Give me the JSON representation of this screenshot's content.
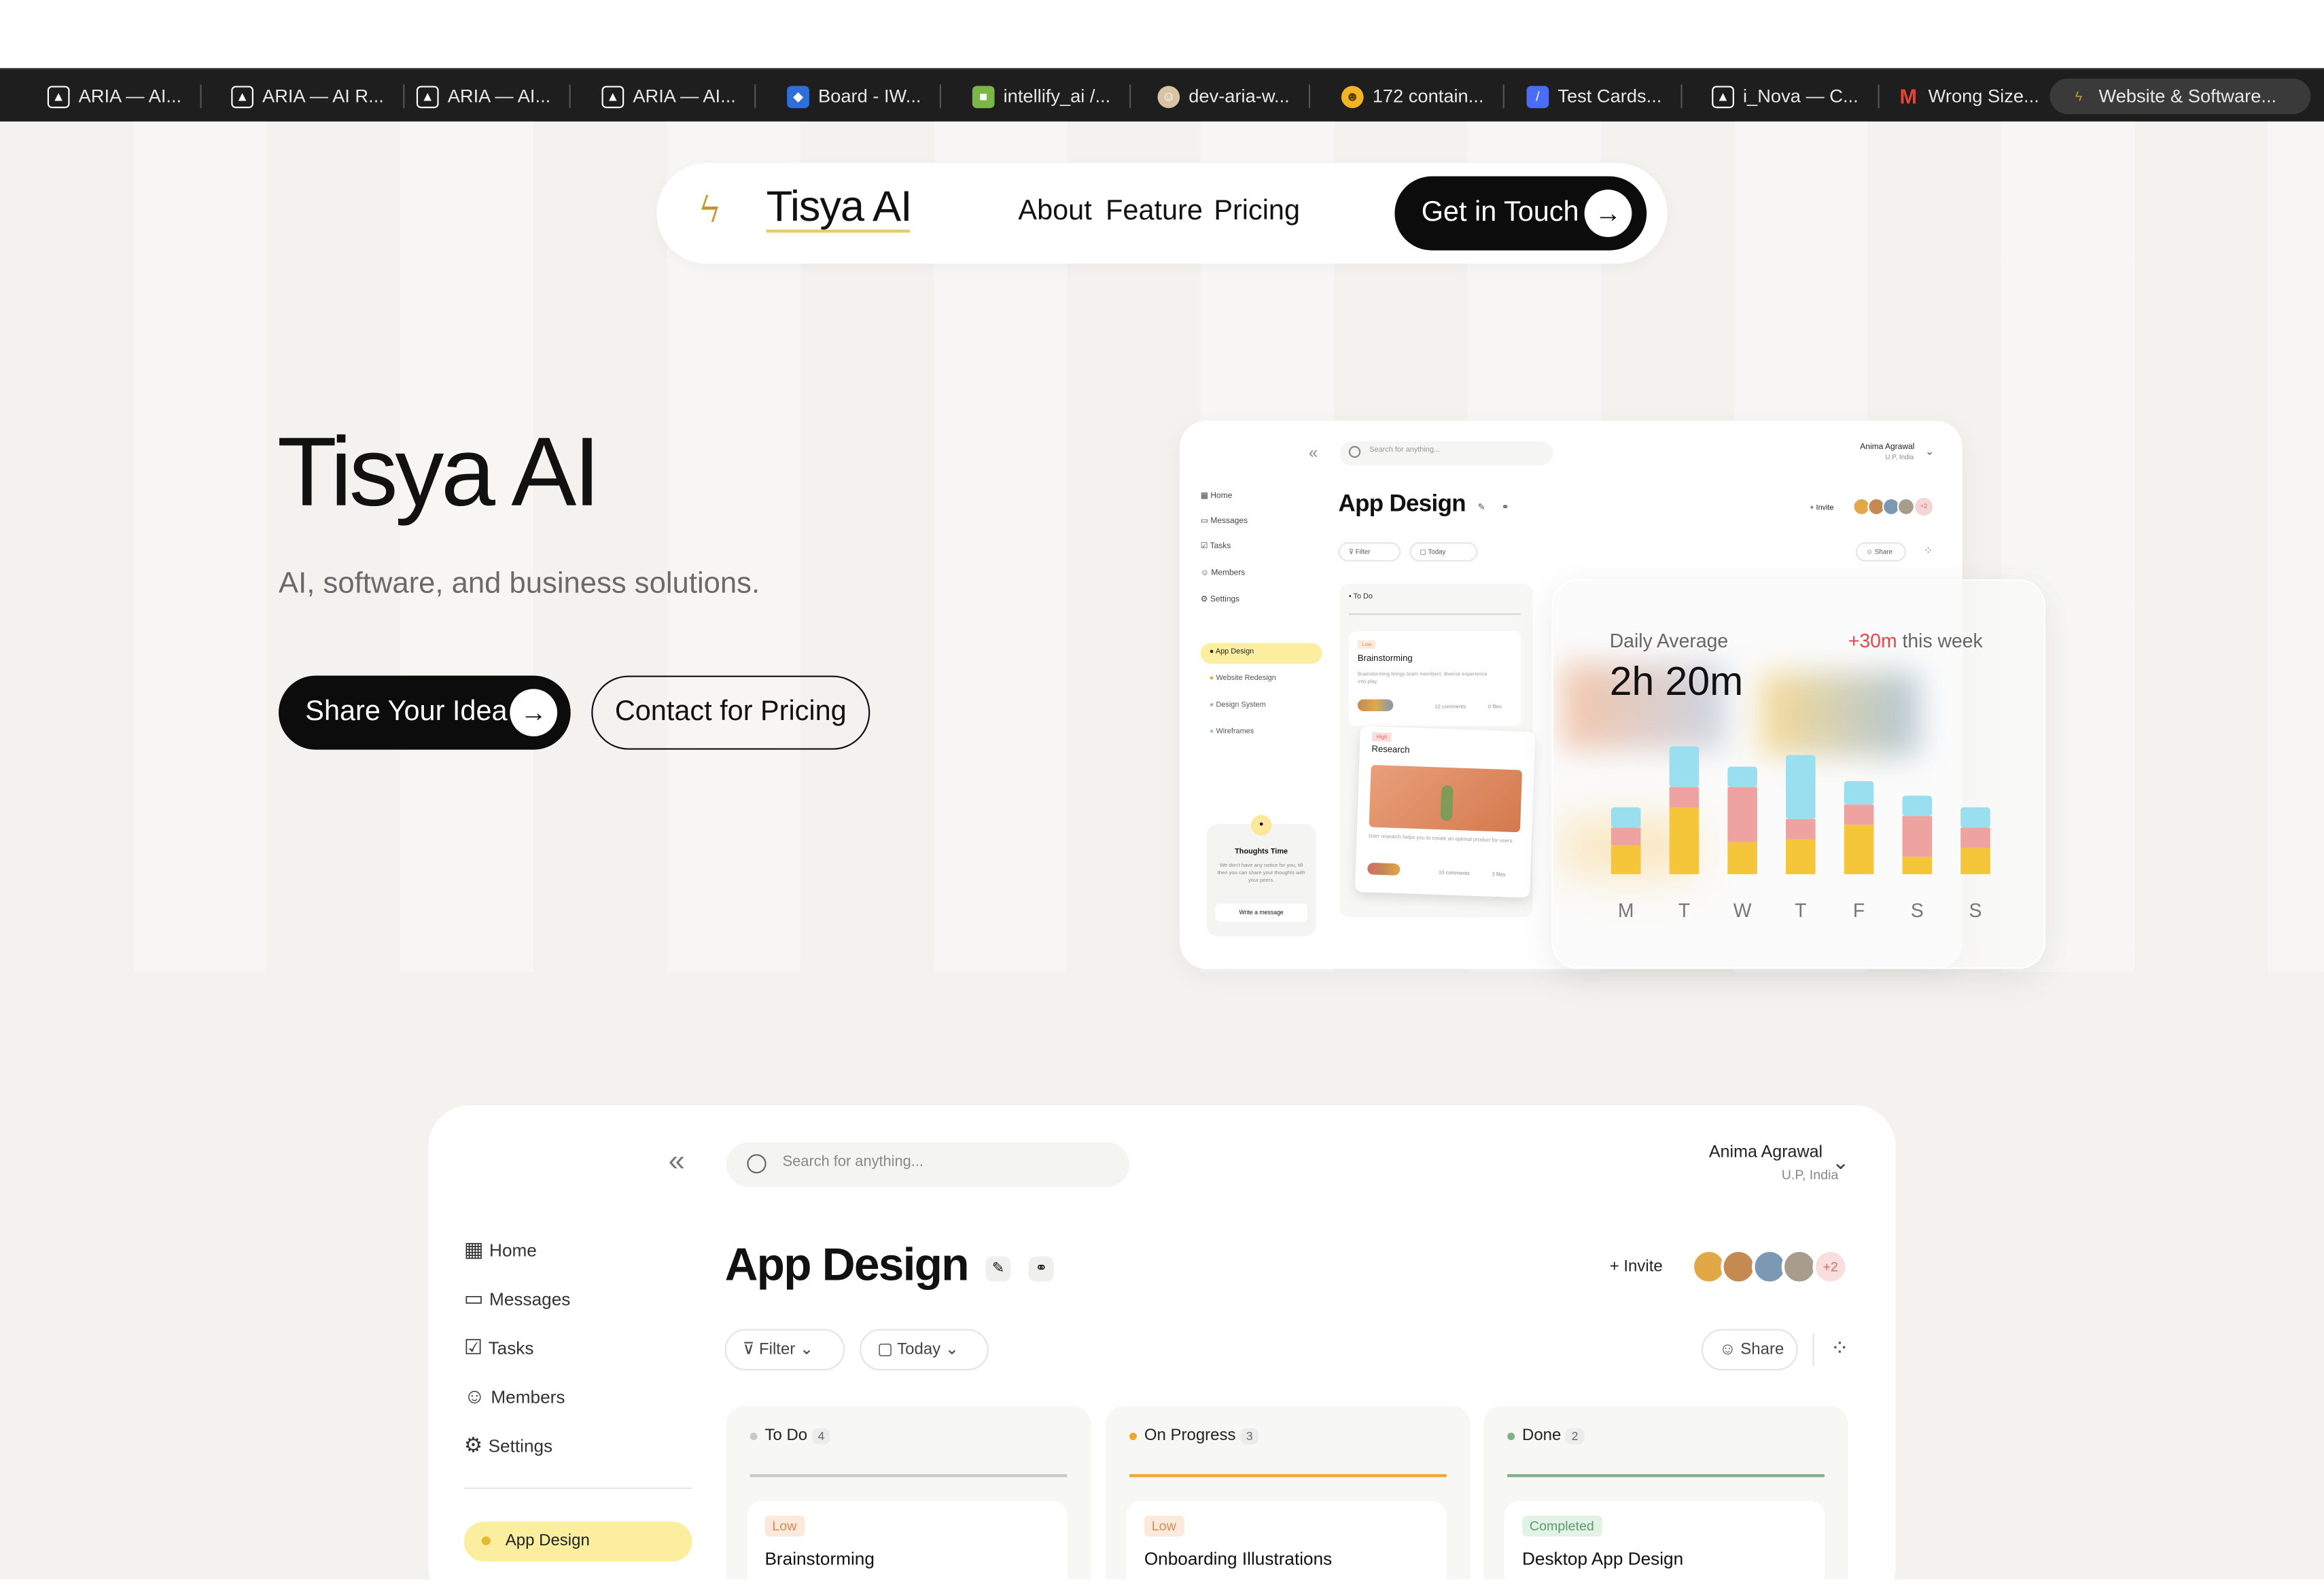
{
  "browser": {
    "tabs": [
      {
        "label": "ARIA — AI...",
        "icon": "aria-icon",
        "color": "#ffffff"
      },
      {
        "label": "ARIA — AI R...",
        "icon": "aria-icon",
        "color": "#ffffff"
      },
      {
        "label": "ARIA — AI...",
        "icon": "aria-icon",
        "color": "#ffffff"
      },
      {
        "label": "ARIA — AI...",
        "icon": "aria-icon",
        "color": "#ffffff"
      },
      {
        "label": "Board - IW...",
        "icon": "jira-icon",
        "color": "#2f6fdc"
      },
      {
        "label": "intellify_ai /...",
        "icon": "bitbucket-icon",
        "color": "#7ab648"
      },
      {
        "label": "dev-aria-w...",
        "icon": "avatar-icon",
        "color": "#d9c3a5"
      },
      {
        "label": "172 contain...",
        "icon": "emoji-icon",
        "color": "#f0b429"
      },
      {
        "label": "Test Cards...",
        "icon": "stripe-icon",
        "color": "#4a6cf7"
      },
      {
        "label": "i_Nova — C...",
        "icon": "aria-icon",
        "color": "#ffffff"
      },
      {
        "label": "Wrong Size...",
        "icon": "gmail-icon",
        "color": "#ea4335"
      },
      {
        "label": "Website & Software...",
        "icon": "tisya-icon",
        "color": "#c8962e",
        "active": true
      }
    ]
  },
  "nav": {
    "brand": "Tisya AI",
    "links": [
      "About",
      "Feature",
      "Pricing"
    ],
    "cta": "Get in Touch"
  },
  "hero": {
    "title": "Tisya AI",
    "subtitle": "AI, software, and business solutions.",
    "primary_button": "Share Your Idea",
    "secondary_button": "Contact for Pricing"
  },
  "preview": {
    "search_placeholder": "Search for anything...",
    "user_name": "Anima Agrawal",
    "user_location": "U.P, India",
    "title": "App Design",
    "invite": "Invite",
    "avatars_more": "+2",
    "filter": "Filter",
    "today": "Today",
    "share": "Share",
    "sidebar": [
      "Home",
      "Messages",
      "Tasks",
      "Members",
      "Settings"
    ],
    "projects": [
      "App Design",
      "Website Redesign",
      "Design System",
      "Wireframes"
    ],
    "thoughts_title": "Thoughts Time",
    "thoughts_text": "We don't have any notice for you, till then you can share your thoughts with your peers.",
    "thoughts_button": "Write a message",
    "todo_label": "To Do",
    "card1_tag": "Low",
    "card1_title": "Brainstorming",
    "card1_desc": "Brainstorming brings team members' diverse experience into play.",
    "card1_comments": "12 comments",
    "card1_files": "0 files",
    "card2_tag": "High",
    "card2_title": "Research",
    "card2_desc": "User research helps you to create an optimal product for users.",
    "card2_comments": "10 comments",
    "card2_files": "3 files"
  },
  "chart_data": {
    "type": "bar",
    "title": "Daily Average",
    "headline": "2h 20m",
    "delta": "+30m",
    "delta_suffix": "this week",
    "categories": [
      "M",
      "T",
      "W",
      "T",
      "F",
      "S",
      "S"
    ],
    "series": [
      {
        "color": "#f5c63a",
        "values": [
          20,
          46,
          22,
          24,
          34,
          12,
          18
        ]
      },
      {
        "color": "#eea3a0",
        "values": [
          12,
          14,
          38,
          14,
          14,
          28,
          14
        ]
      },
      {
        "color": "#99dff0",
        "values": [
          14,
          28,
          14,
          44,
          16,
          14,
          14
        ]
      }
    ]
  },
  "dashboard": {
    "search_placeholder": "Search for anything...",
    "user_name": "Anima Agrawal",
    "user_location": "U.P, India",
    "title": "App Design",
    "invite": "Invite",
    "avatars_more": "+2",
    "filter": "Filter",
    "today": "Today",
    "share": "Share",
    "sidebar": [
      "Home",
      "Messages",
      "Tasks",
      "Members",
      "Settings"
    ],
    "active_project": "App Design",
    "columns": [
      {
        "name": "To Do",
        "count": "4",
        "color": "#c9c9c9",
        "card_tag": "Low",
        "card_title": "Brainstorming"
      },
      {
        "name": "On Progress",
        "count": "3",
        "color": "#f0a52e",
        "card_tag": "Low",
        "card_title": "Onboarding Illustrations"
      },
      {
        "name": "Done",
        "count": "2",
        "color": "#7fb08a",
        "card_tag": "Completed",
        "card_title": "Desktop App Design"
      }
    ]
  }
}
